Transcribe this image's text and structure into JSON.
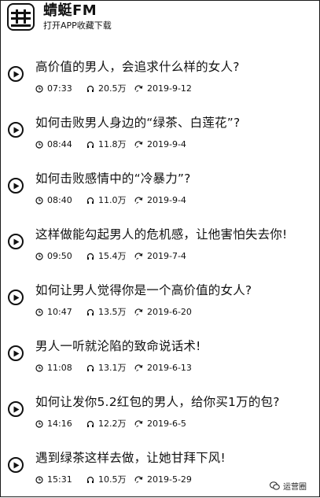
{
  "app": {
    "name": "蜻蜓FM",
    "subtitle": "打开APP收藏下载"
  },
  "items": [
    {
      "title": "高价值的男人，会追求什么样的女人?",
      "duration": "07:33",
      "plays": "20.5万",
      "date": "2019-9-12"
    },
    {
      "title": "如何击败男人身边的“绿茶、白莲花”?",
      "duration": "08:44",
      "plays": "11.8万",
      "date": "2019-9-4"
    },
    {
      "title": "如何击败感情中的“冷暴力”?",
      "duration": "08:40",
      "plays": "11.0万",
      "date": "2019-9-4"
    },
    {
      "title": "这样做能勾起男人的危机感，让他害怕失去你!",
      "duration": "09:50",
      "plays": "15.4万",
      "date": "2019-7-4"
    },
    {
      "title": "如何让男人觉得你是一个高价值的女人?",
      "duration": "10:47",
      "plays": "13.5万",
      "date": "2019-6-20"
    },
    {
      "title": "男人一听就沦陷的致命说话术!",
      "duration": "11:08",
      "plays": "13.1万",
      "date": "2019-6-13"
    },
    {
      "title": "如何让发你5.2红包的男人，给你买1万的包?",
      "duration": "14:16",
      "plays": "12.2万",
      "date": "2019-6-5"
    },
    {
      "title": "遇到绿茶这样去做，让她甘拜下风!",
      "duration": "15:31",
      "plays": "10.5万",
      "date": "2019-5-29"
    }
  ],
  "watermark": {
    "text": "运营圈"
  }
}
